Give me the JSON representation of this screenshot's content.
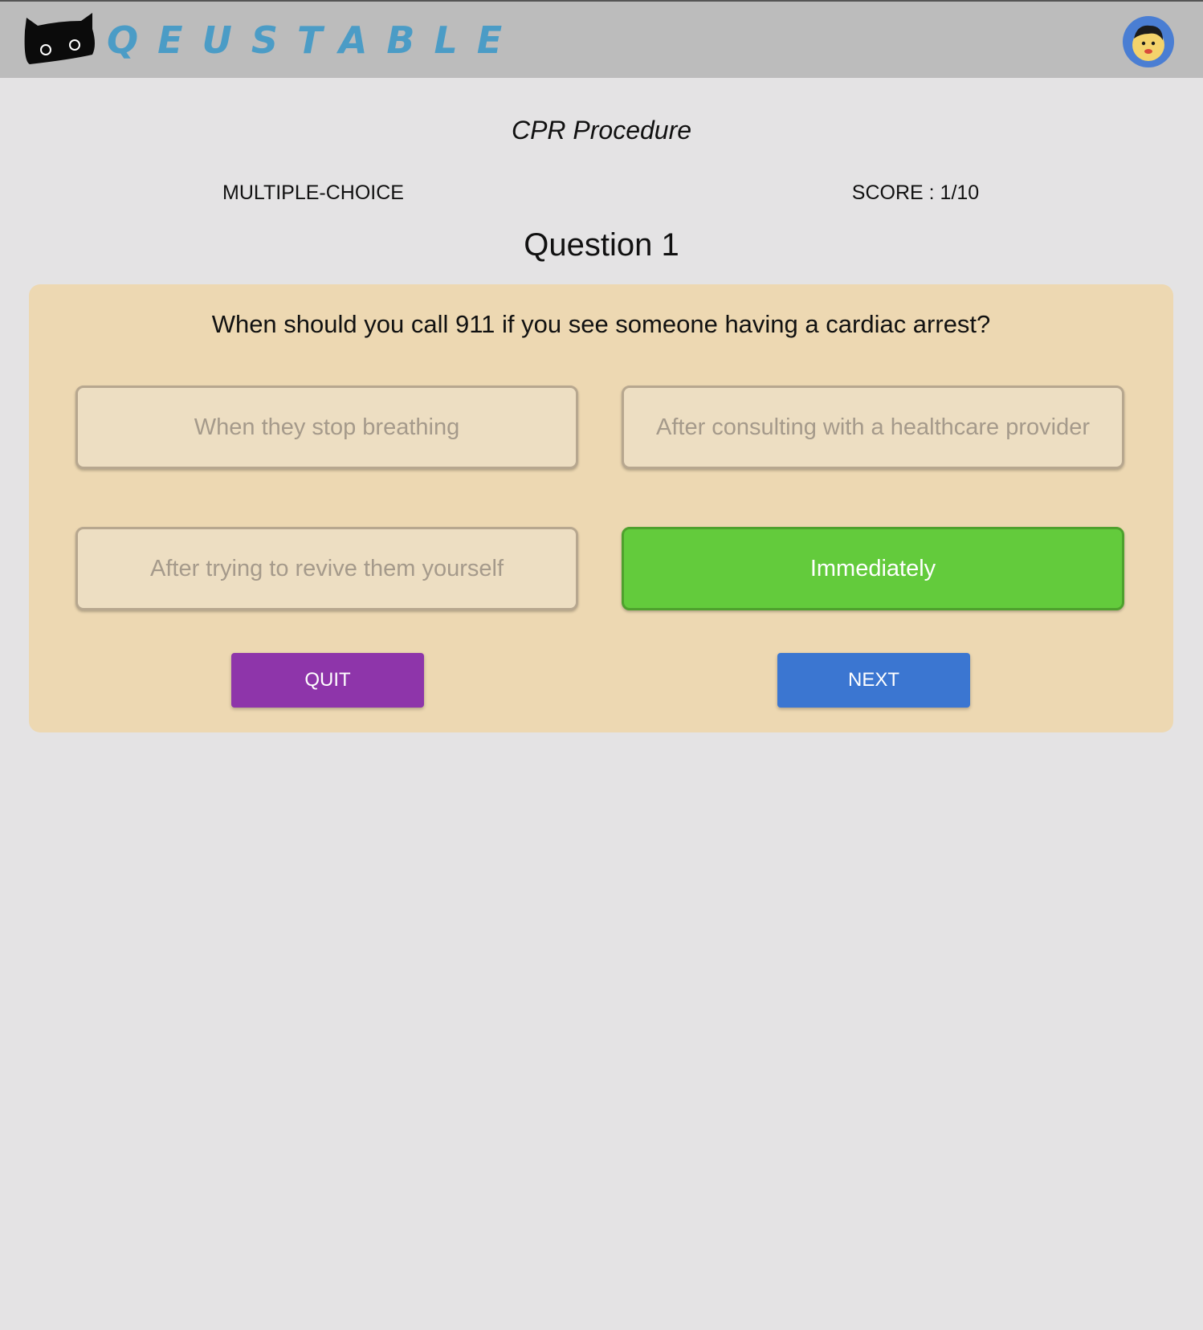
{
  "header": {
    "brand": "QEUSTABLE",
    "logo_icon": "black-cat-icon",
    "avatar_icon": "user-avatar-icon"
  },
  "quiz": {
    "title": "CPR Procedure",
    "type": "MULTIPLE-CHOICE",
    "score": "SCORE : 1/10",
    "question_heading": "Question 1",
    "question_text": "When should you call 911 if you see someone having a cardiac arrest?",
    "options": [
      {
        "label": "When they stop breathing",
        "state": "default"
      },
      {
        "label": "After consulting with a healthcare provider",
        "state": "default"
      },
      {
        "label": "After trying to revive them yourself",
        "state": "default"
      },
      {
        "label": "Immediately",
        "state": "correct"
      }
    ]
  },
  "actions": {
    "quit_label": "QUIT",
    "next_label": "NEXT"
  },
  "colors": {
    "header_bg": "#bcbcbc",
    "page_bg": "#e4e3e4",
    "card_bg": "#edd8b2",
    "brand_blue": "#4b9cc6",
    "correct_green": "#63cb3c",
    "quit_purple": "#8e35aa",
    "next_blue": "#3b76d1"
  }
}
